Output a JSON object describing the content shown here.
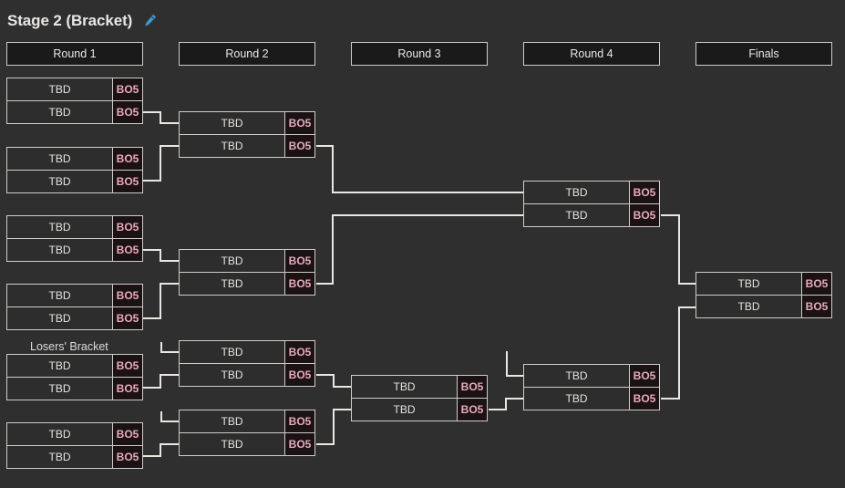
{
  "header": {
    "title": "Stage 2 (Bracket)",
    "edit_icon": "pencil-icon"
  },
  "colors": {
    "background": "#302f2f",
    "match_bg": "#2e2d2d",
    "bo_bg": "#1a1213",
    "bo_text": "#eaa9c0",
    "border": "#cfcdc7",
    "wire": "#e9e7df",
    "edit_icon": "#3a9bd9",
    "text": "#e6e4e0"
  },
  "labels": {
    "losers_bracket": "Losers' Bracket"
  },
  "rounds": [
    {
      "id": "round-1",
      "label": "Round 1"
    },
    {
      "id": "round-2",
      "label": "Round 2"
    },
    {
      "id": "round-3",
      "label": "Round 3"
    },
    {
      "id": "round-4",
      "label": "Round 4"
    },
    {
      "id": "finals",
      "label": "Finals"
    }
  ],
  "matches": [
    {
      "id": "r1-m1",
      "round": "Round 1",
      "bracket": "winners",
      "team1": "TBD",
      "team2": "TBD",
      "format1": "BO5",
      "format2": "BO5"
    },
    {
      "id": "r1-m2",
      "round": "Round 1",
      "bracket": "winners",
      "team1": "TBD",
      "team2": "TBD",
      "format1": "BO5",
      "format2": "BO5"
    },
    {
      "id": "r1-m3",
      "round": "Round 1",
      "bracket": "winners",
      "team1": "TBD",
      "team2": "TBD",
      "format1": "BO5",
      "format2": "BO5"
    },
    {
      "id": "r1-m4",
      "round": "Round 1",
      "bracket": "winners",
      "team1": "TBD",
      "team2": "TBD",
      "format1": "BO5",
      "format2": "BO5"
    },
    {
      "id": "r1-m5",
      "round": "Round 1",
      "bracket": "losers",
      "team1": "TBD",
      "team2": "TBD",
      "format1": "BO5",
      "format2": "BO5"
    },
    {
      "id": "r1-m6",
      "round": "Round 1",
      "bracket": "losers",
      "team1": "TBD",
      "team2": "TBD",
      "format1": "BO5",
      "format2": "BO5"
    },
    {
      "id": "r2-m1",
      "round": "Round 2",
      "bracket": "winners",
      "team1": "TBD",
      "team2": "TBD",
      "format1": "BO5",
      "format2": "BO5"
    },
    {
      "id": "r2-m2",
      "round": "Round 2",
      "bracket": "winners",
      "team1": "TBD",
      "team2": "TBD",
      "format1": "BO5",
      "format2": "BO5"
    },
    {
      "id": "r2-m3",
      "round": "Round 2",
      "bracket": "losers",
      "team1": "TBD",
      "team2": "TBD",
      "format1": "BO5",
      "format2": "BO5"
    },
    {
      "id": "r2-m4",
      "round": "Round 2",
      "bracket": "losers",
      "team1": "TBD",
      "team2": "TBD",
      "format1": "BO5",
      "format2": "BO5"
    },
    {
      "id": "r3-m1",
      "round": "Round 3",
      "bracket": "losers",
      "team1": "TBD",
      "team2": "TBD",
      "format1": "BO5",
      "format2": "BO5"
    },
    {
      "id": "r4-m1",
      "round": "Round 4",
      "bracket": "winners",
      "team1": "TBD",
      "team2": "TBD",
      "format1": "BO5",
      "format2": "BO5"
    },
    {
      "id": "r4-m2",
      "round": "Round 4",
      "bracket": "losers",
      "team1": "TBD",
      "team2": "TBD",
      "format1": "BO5",
      "format2": "BO5"
    },
    {
      "id": "f-m1",
      "round": "Finals",
      "bracket": "finals",
      "team1": "TBD",
      "team2": "TBD",
      "format1": "BO5",
      "format2": "BO5"
    }
  ]
}
